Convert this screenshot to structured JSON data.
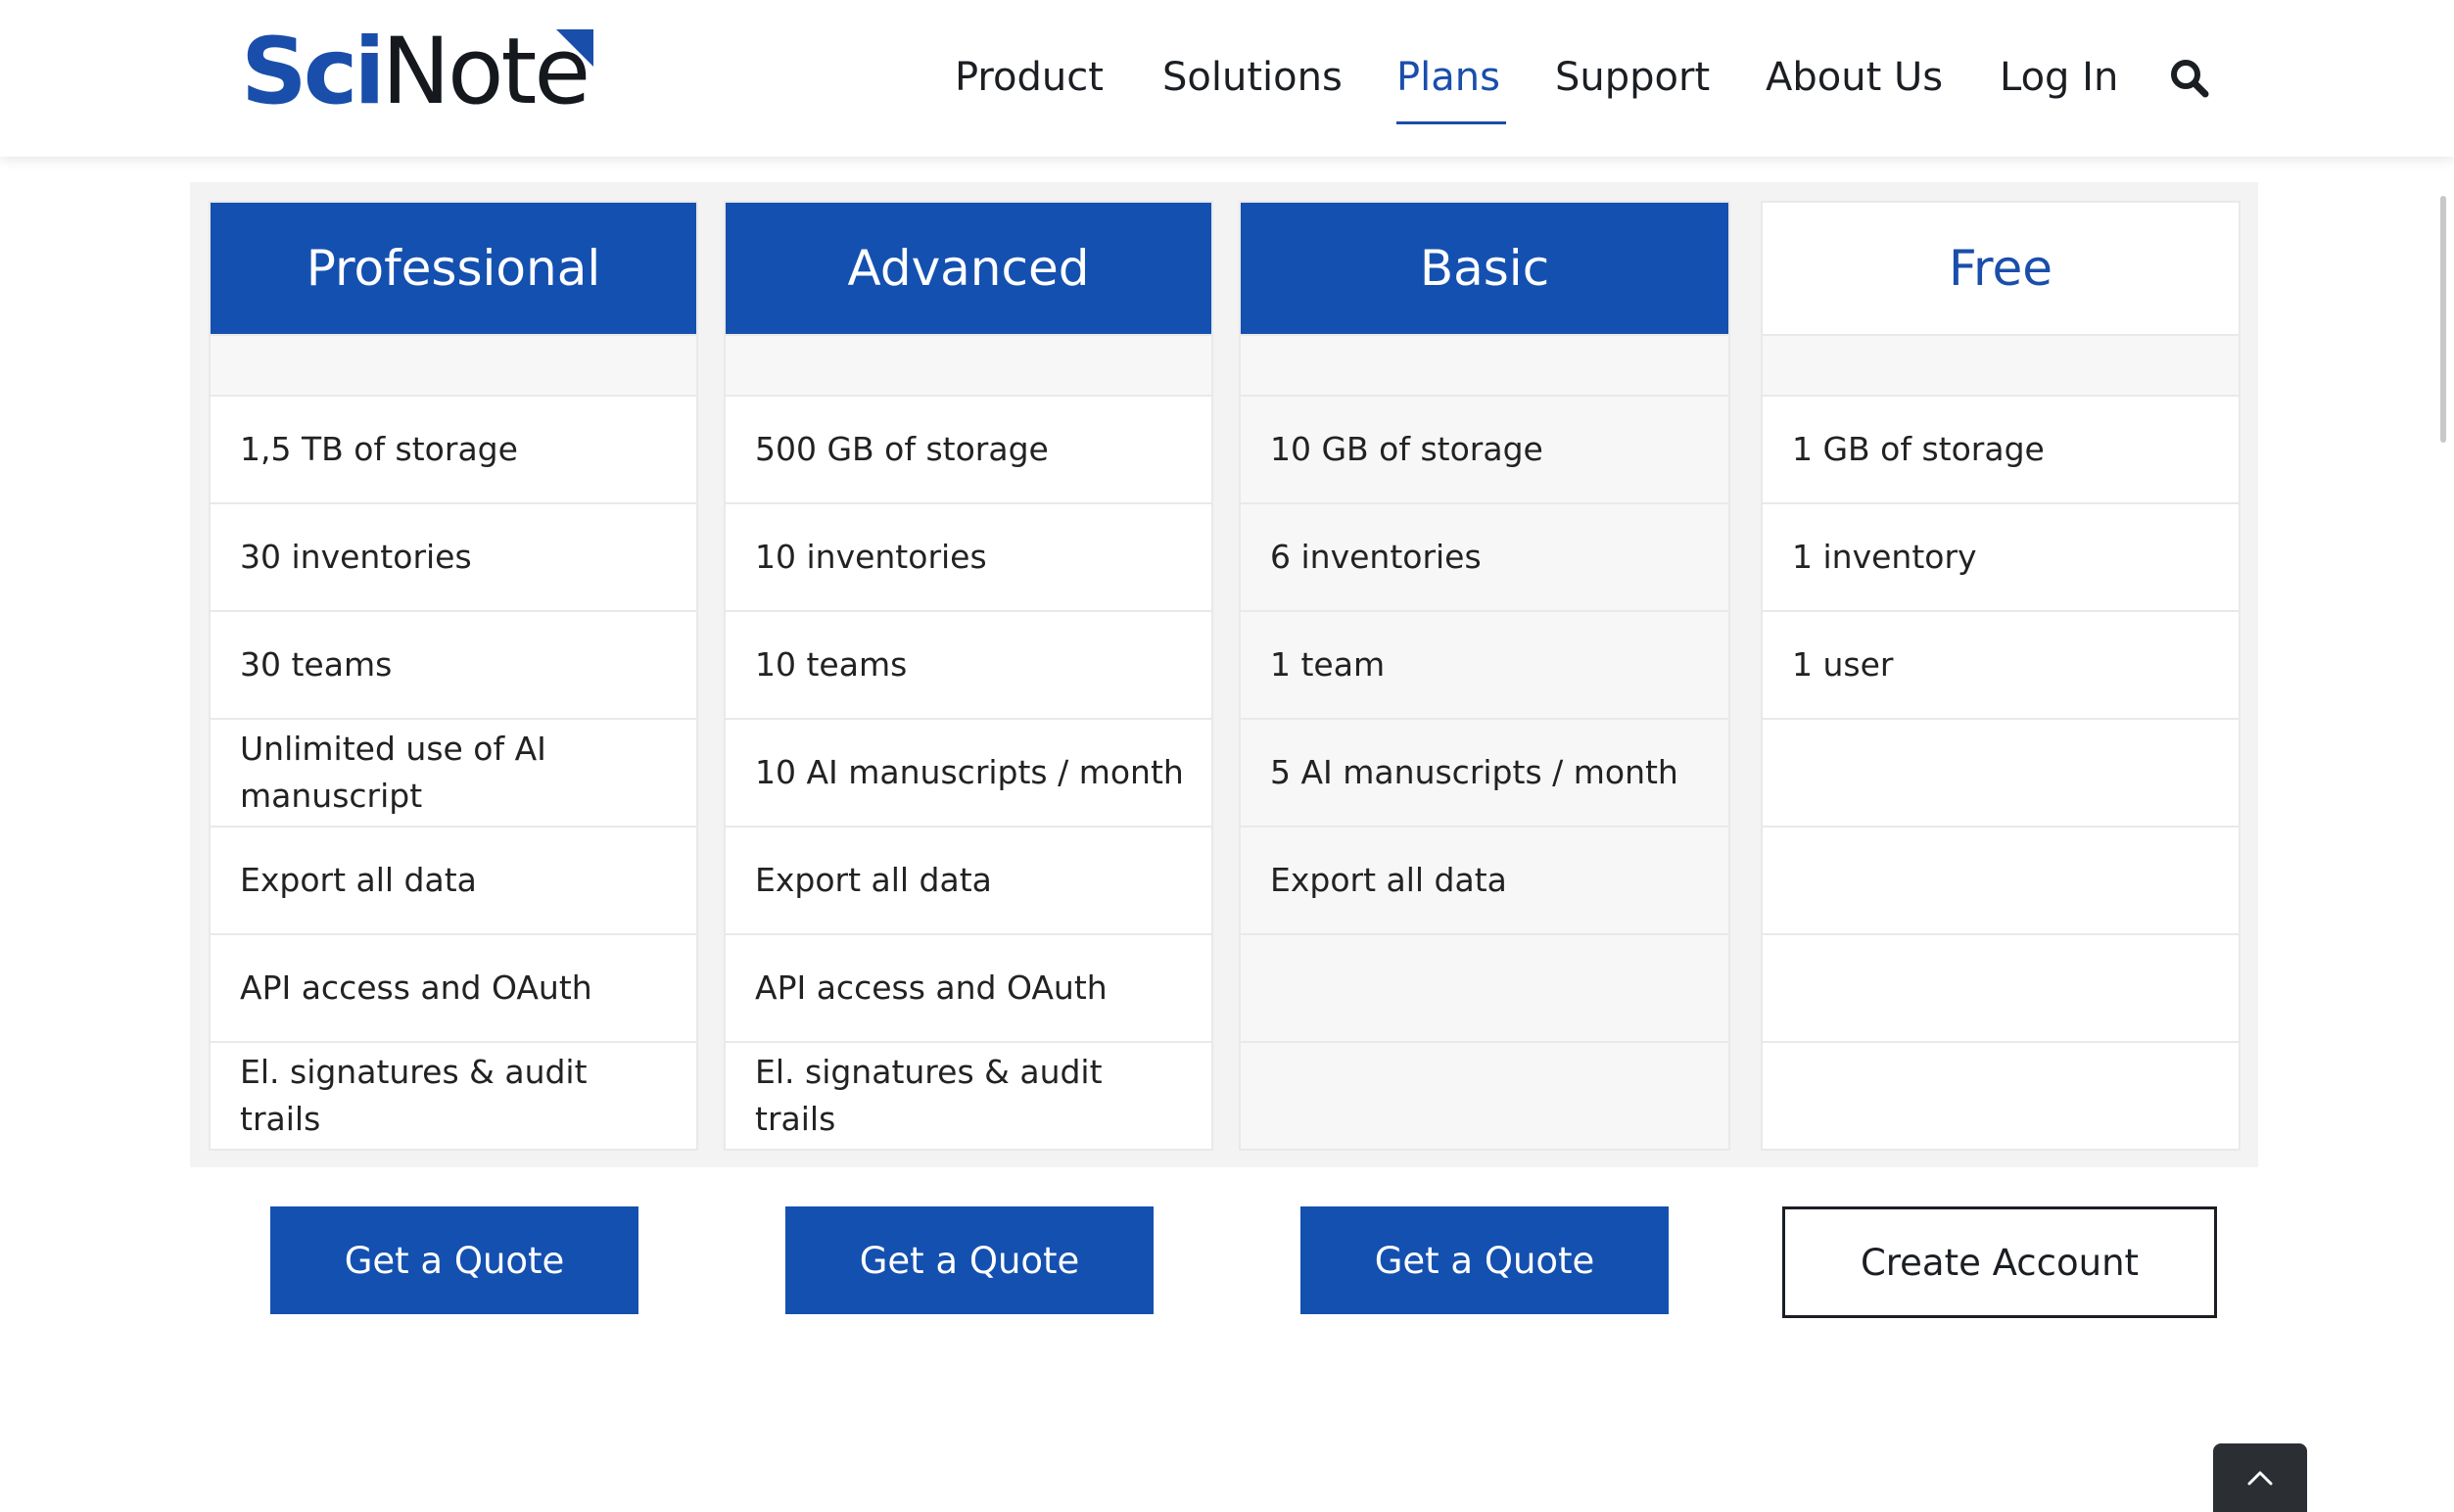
{
  "brand": {
    "logo_part1": "Sci",
    "logo_part2": "Note",
    "colors": {
      "primary": "#1450b0",
      "text": "#1b1e23",
      "muted": "#f3f3f3"
    }
  },
  "nav": {
    "items": [
      {
        "label": "Product"
      },
      {
        "label": "Solutions"
      },
      {
        "label": "Plans",
        "active": true
      },
      {
        "label": "Support"
      },
      {
        "label": "About Us"
      },
      {
        "label": "Log In"
      }
    ],
    "search_icon": "search-icon"
  },
  "plans": [
    {
      "name": "Professional",
      "features": [
        "1,5 TB of storage",
        "30 inventories",
        "30 teams",
        "Unlimited use of AI manuscript",
        "Export all data",
        "API access and OAuth",
        "El. signatures & audit trails"
      ],
      "cta": "Get a Quote"
    },
    {
      "name": "Advanced",
      "features": [
        "500 GB of storage",
        "10 inventories",
        "10 teams",
        "10 AI manuscripts / month",
        "Export all data",
        "API access and OAuth",
        "El. signatures & audit trails"
      ],
      "cta": "Get a Quote"
    },
    {
      "name": "Basic",
      "features": [
        "10 GB of storage",
        "6 inventories",
        "1 team",
        "5 AI manuscripts / month",
        "Export all data",
        "",
        ""
      ],
      "cta": "Get a Quote"
    },
    {
      "name": "Free",
      "features": [
        "1 GB of storage",
        "1 inventory",
        "1 user",
        "",
        "",
        "",
        ""
      ],
      "cta": "Create Account"
    }
  ],
  "back_to_top_icon": "chevron-up-icon"
}
